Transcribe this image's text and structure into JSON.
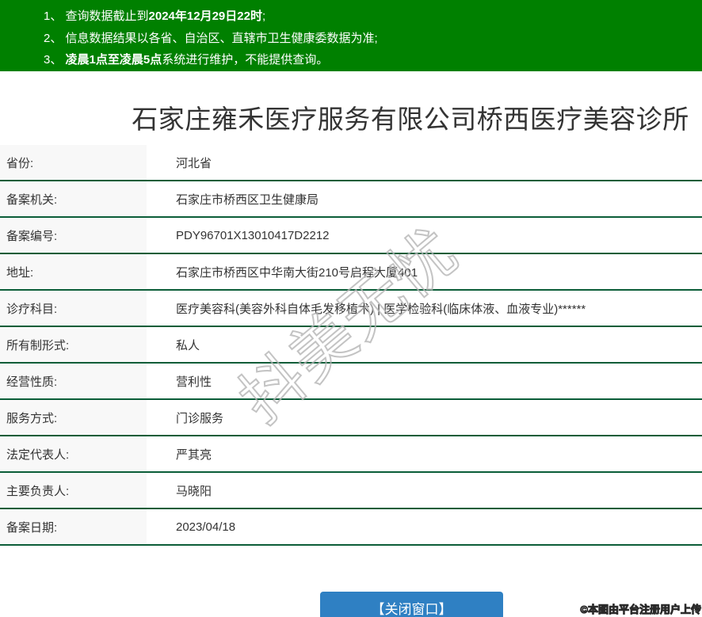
{
  "notices": [
    {
      "segments": [
        {
          "t": "1、 查询数据截止到",
          "b": false
        },
        {
          "t": "2024年12月29日22时",
          "b": true
        },
        {
          "t": ";",
          "b": false
        }
      ]
    },
    {
      "segments": [
        {
          "t": "2、 信息数据结果以各省、自治区、直辖市卫生健康委数据为准;",
          "b": false
        }
      ]
    },
    {
      "segments": [
        {
          "t": "3、 ",
          "b": false
        },
        {
          "t": "凌晨1点至凌晨5点",
          "b": true
        },
        {
          "t": "系统进行维护，不能提供查询。",
          "b": false
        }
      ]
    }
  ],
  "title": "石家庄雍禾医疗服务有限公司桥西医疗美容诊所",
  "table": {
    "rows": [
      {
        "label": "省份:",
        "value": "河北省"
      },
      {
        "label": "备案机关:",
        "value": "石家庄市桥西区卫生健康局"
      },
      {
        "label": "备案编号:",
        "value": "PDY96701X13010417D2212"
      },
      {
        "label": "地址:",
        "value": "石家庄市桥西区中华南大街210号启程大厦401"
      },
      {
        "label": "诊疗科目:",
        "value": "医疗美容科(美容外科自体毛发移植术) | 医学检验科(临床体液、血液专业)******"
      },
      {
        "label": "所有制形式:",
        "value": "私人"
      },
      {
        "label": "经营性质:",
        "value": "营利性"
      },
      {
        "label": "服务方式:",
        "value": "门诊服务"
      },
      {
        "label": "法定代表人:",
        "value": "严其亮"
      },
      {
        "label": "主要负责人:",
        "value": "马晓阳"
      },
      {
        "label": "备案日期:",
        "value": "2023/04/18"
      }
    ]
  },
  "watermark": "抖美无忧",
  "close_button": "【关闭窗口】",
  "footer_stamp": "©本图由平台注册用户上传",
  "colors": {
    "header_bg": "#008000",
    "row_divider": "#0b5d38",
    "label_col_bg": "#f8f8f8",
    "button_bg": "#2f80c3",
    "text": "#333333",
    "watermark_stroke": "#b5b5b5"
  }
}
